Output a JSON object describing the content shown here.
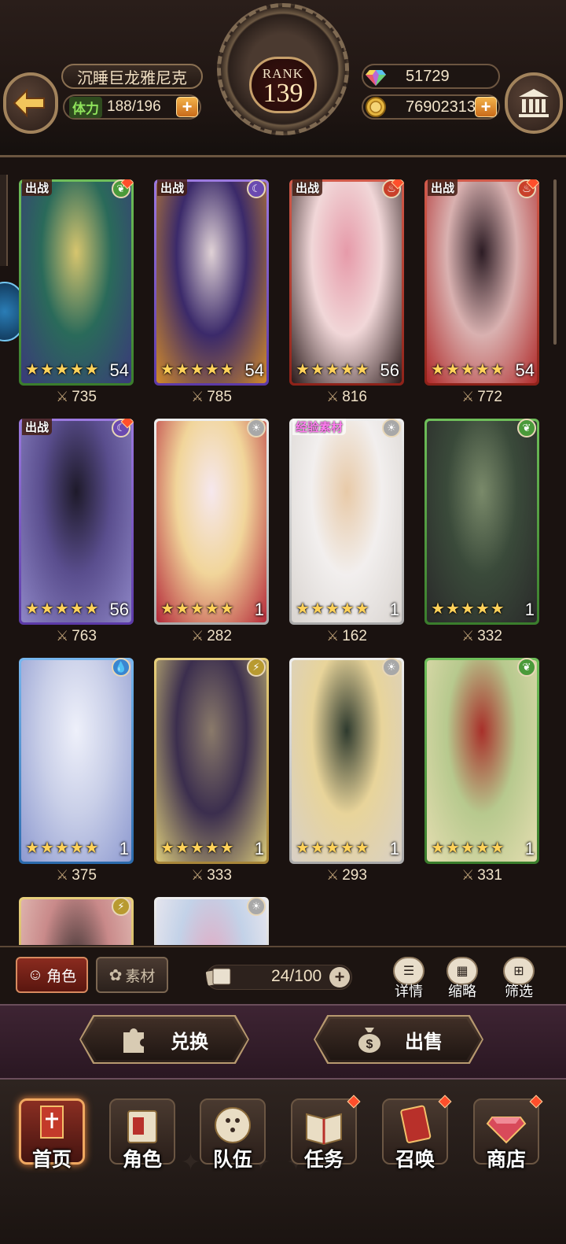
{
  "header": {
    "player_name": "沉睡巨龙雅尼克",
    "stamina_label": "体力",
    "stamina_value": "188/196",
    "rank_label": "RANK",
    "rank_value": "139",
    "gems": "51729",
    "gold": "76902313",
    "back_icon": "back-arrow-icon",
    "bank_icon": "bank-icon"
  },
  "cards": [
    {
      "tag": "出战",
      "element": "nature",
      "stars": 5,
      "level": "54",
      "power": "735",
      "frame": "green",
      "art_colors": [
        "#2a6a5a",
        "#d7c56e",
        "#3a3a7a"
      ],
      "new": true
    },
    {
      "tag": "出战",
      "element": "dark",
      "stars": 5,
      "level": "54",
      "power": "785",
      "frame": "purple",
      "art_colors": [
        "#3b2a6a",
        "#e0d2d6",
        "#d18a2a"
      ],
      "new": false
    },
    {
      "tag": "出战",
      "element": "fire",
      "stars": 5,
      "level": "56",
      "power": "816",
      "frame": "red",
      "art_colors": [
        "#f1d7d8",
        "#e69aa9",
        "#2a1a1a"
      ],
      "new": true
    },
    {
      "tag": "出战",
      "element": "fire",
      "stars": 5,
      "level": "54",
      "power": "772",
      "frame": "red",
      "art_colors": [
        "#d9b1b0",
        "#2c1c24",
        "#b02a2a"
      ],
      "new": true
    },
    {
      "tag": "出战",
      "element": "dark",
      "stars": 5,
      "level": "56",
      "power": "763",
      "frame": "purple",
      "art_colors": [
        "#5a4e8e",
        "#1e1a2a",
        "#8e86c6"
      ],
      "new": true
    },
    {
      "tag": "",
      "element": "light",
      "stars": 5,
      "level": "1",
      "power": "282",
      "frame": "white",
      "art_colors": [
        "#f1d59a",
        "#f6e8ee",
        "#b52a3a"
      ],
      "new": false
    },
    {
      "tag": "经验素材",
      "element": "light",
      "stars": 5,
      "level": "1",
      "power": "162",
      "frame": "white",
      "art_colors": [
        "#f2efee",
        "#e8caa8",
        "#d9d4d0"
      ],
      "new": false
    },
    {
      "tag": "",
      "element": "nature",
      "stars": 5,
      "level": "1",
      "power": "332",
      "frame": "green",
      "art_colors": [
        "#3a4a3a",
        "#7a8a6a",
        "#2a2a2a"
      ],
      "new": false
    },
    {
      "tag": "",
      "element": "water",
      "stars": 5,
      "level": "1",
      "power": "375",
      "frame": "blue",
      "art_colors": [
        "#c9cfe8",
        "#eef0fa",
        "#8e9ad0"
      ],
      "new": false
    },
    {
      "tag": "",
      "element": "thunder",
      "stars": 5,
      "level": "1",
      "power": "333",
      "frame": "gold",
      "art_colors": [
        "#3b2e4e",
        "#8a7a6a",
        "#d9c97a"
      ],
      "new": false
    },
    {
      "tag": "",
      "element": "light",
      "stars": 5,
      "level": "1",
      "power": "293",
      "frame": "white",
      "art_colors": [
        "#e8d49a",
        "#2e3a2e",
        "#d8d0c6"
      ],
      "new": false
    },
    {
      "tag": "",
      "element": "nature",
      "stars": 5,
      "level": "1",
      "power": "331",
      "frame": "green",
      "art_colors": [
        "#b7c98e",
        "#a8302a",
        "#e4ddb0"
      ],
      "new": false
    },
    {
      "tag": "",
      "element": "thunder",
      "stars": 0,
      "level": "",
      "power": "",
      "frame": "gold",
      "art_colors": [
        "#c98a8a",
        "#3a3030",
        "#e8c8c0"
      ],
      "new": false
    },
    {
      "tag": "",
      "element": "light",
      "stars": 0,
      "level": "",
      "power": "",
      "frame": "white",
      "art_colors": [
        "#c3d2e8",
        "#e4a8c0",
        "#f6eef0"
      ],
      "new": false
    }
  ],
  "toolbar": {
    "tab_roles": "角色",
    "tab_materials": "素材",
    "capacity": "24/100",
    "details": "详情",
    "thumbnail": "缩略",
    "filter": "筛选"
  },
  "actions": {
    "exchange": "兑换",
    "sell": "出售"
  },
  "nav": [
    {
      "label": "首页",
      "icon": "home-banner-icon",
      "active": true,
      "dot": false
    },
    {
      "label": "角色",
      "icon": "character-card-icon",
      "active": false,
      "dot": false
    },
    {
      "label": "队伍",
      "icon": "team-shield-icon",
      "active": false,
      "dot": false
    },
    {
      "label": "任务",
      "icon": "quest-book-icon",
      "active": false,
      "dot": true
    },
    {
      "label": "召唤",
      "icon": "summon-card-icon",
      "active": false,
      "dot": true
    },
    {
      "label": "商店",
      "icon": "shop-gem-icon",
      "active": false,
      "dot": true
    }
  ],
  "colors": {
    "accent": "#f0a860",
    "new_badge": "#ff4e2b",
    "star": "#ffd25a"
  }
}
